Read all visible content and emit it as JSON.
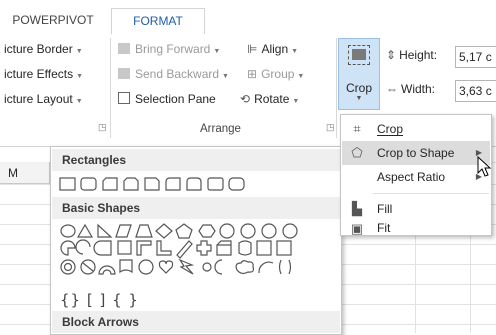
{
  "tabs": [
    {
      "label": "POWERPIVOT",
      "active": false
    },
    {
      "label": "FORMAT",
      "active": true
    }
  ],
  "picture_styles": {
    "items": [
      "icture Border",
      "icture Effects",
      "icture Layout"
    ]
  },
  "arrange": {
    "bring_forward": "Bring Forward",
    "send_backward": "Send Backward",
    "selection_pane": "Selection Pane",
    "align": "Align",
    "group": "Group",
    "rotate": "Rotate",
    "group_label": "Arrange"
  },
  "size": {
    "crop_label": "Crop",
    "height_label": "Height:",
    "height_value": "5,17 c",
    "width_label": "Width:",
    "width_value": "3,63 c"
  },
  "sheet": {
    "column_header": "M"
  },
  "gallery": {
    "sections": [
      "Rectangles",
      "Basic Shapes",
      "Block Arrows"
    ],
    "basic_row4": "{} [  ]  {  }"
  },
  "crop_menu": {
    "items": [
      {
        "label": "Crop",
        "icon": "crop-icon"
      },
      {
        "label": "Crop to Shape",
        "icon": "crop-to-shape-icon",
        "submenu": true
      },
      {
        "label": "Aspect Ratio",
        "icon": "",
        "submenu": true
      },
      {
        "label": "Fill",
        "icon": "fill-icon"
      },
      {
        "label": "Fit",
        "icon": "fit-icon"
      }
    ]
  },
  "colors": {
    "accent": "#1f5fa8",
    "crop_button_bg": "#cfe3f6",
    "hover": "#dcdcdc"
  }
}
